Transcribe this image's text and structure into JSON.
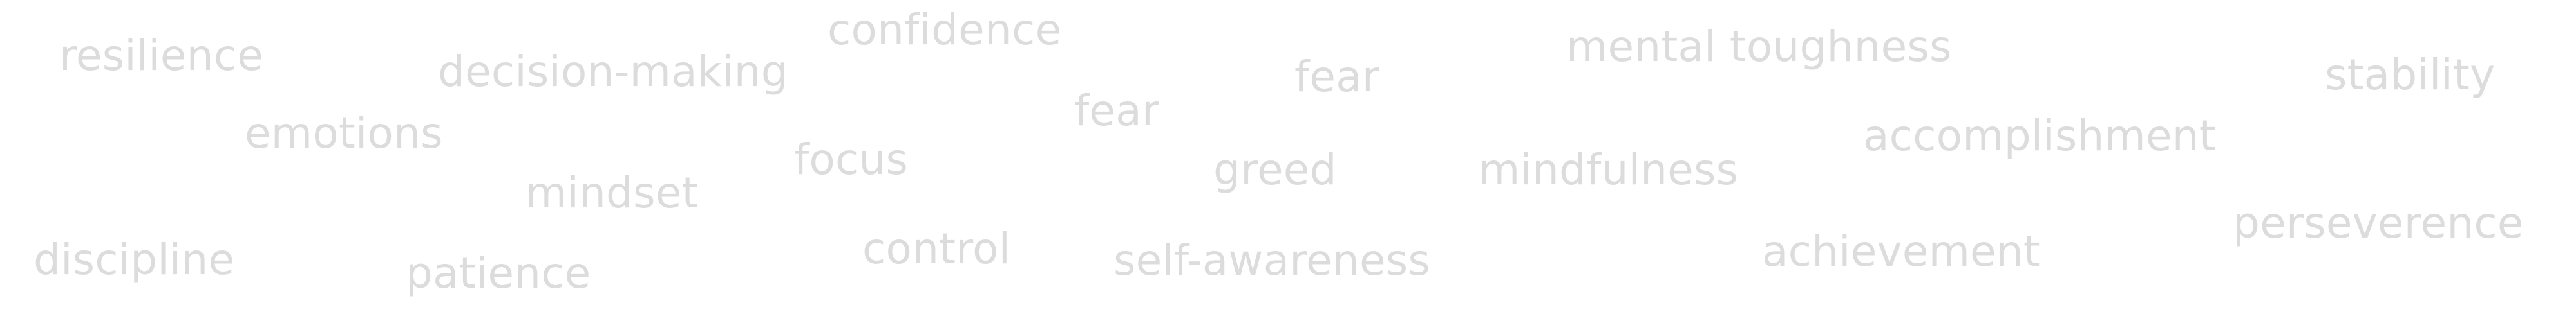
{
  "words": {
    "resilience": "resilience",
    "decision_making": "decision-making",
    "confidence": "confidence",
    "fear_1": "fear",
    "fear_2": "fear",
    "mental_toughness": "mental toughness",
    "stability": "stability",
    "emotions": "emotions",
    "mindset": "mindset",
    "focus": "focus",
    "greed": "greed",
    "mindfulness": "mindfulness",
    "accomplishment": "accomplishment",
    "discipline": "discipline",
    "patience": "patience",
    "control": "control",
    "self_awareness": "self-awareness",
    "achievement": "achievement",
    "perseverence": "perseverence"
  },
  "colors": {
    "background": "#ffffff",
    "text": "#dcdcdc"
  }
}
